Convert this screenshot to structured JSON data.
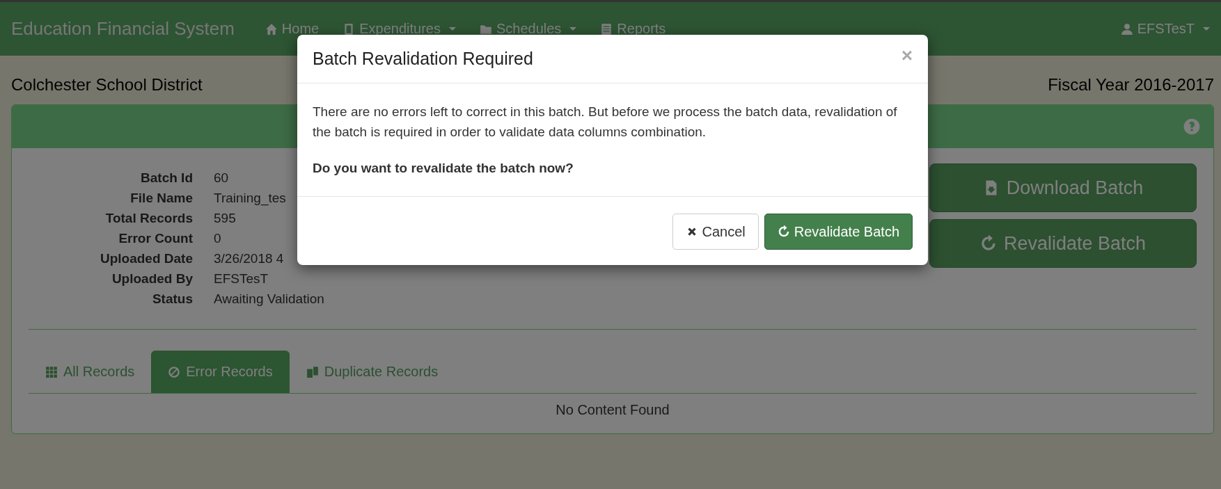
{
  "navbar": {
    "brand": "Education Financial System",
    "items": [
      {
        "label": "Home",
        "dropdown": false
      },
      {
        "label": "Expenditures",
        "dropdown": true
      },
      {
        "label": "Schedules",
        "dropdown": true
      },
      {
        "label": "Reports",
        "dropdown": false
      }
    ],
    "user": {
      "label": "EFSTesT",
      "dropdown": true
    }
  },
  "header": {
    "district": "Colchester School District",
    "fiscal_year": "Fiscal Year 2016-2017"
  },
  "panel": {
    "details": [
      {
        "label": "Batch Id",
        "value": "60"
      },
      {
        "label": "File Name",
        "value": "Training_tes"
      },
      {
        "label": "Total Records",
        "value": "595"
      },
      {
        "label": "Error Count",
        "value": "0"
      },
      {
        "label": "Uploaded Date",
        "value": "3/26/2018 4"
      },
      {
        "label": "Uploaded By",
        "value": "EFSTesT"
      },
      {
        "label": "Status",
        "value": "Awaiting Validation"
      }
    ],
    "actions": [
      {
        "label": "Download Batch"
      },
      {
        "label": "Revalidate Batch"
      }
    ],
    "tabs": [
      {
        "label": "All Records",
        "selected": false
      },
      {
        "label": "Error Records",
        "selected": true
      },
      {
        "label": "Duplicate Records",
        "selected": false
      }
    ],
    "empty_message": "No Content Found"
  },
  "modal": {
    "title": "Batch Revalidation Required",
    "close": "×",
    "message": "There are no errors left to correct in this batch. But before we process the batch data, revalidation of the batch is required in order to validate data columns combination.",
    "question": "Do you want to revalidate the batch now?",
    "buttons": [
      {
        "kind": "default",
        "label": "Cancel"
      },
      {
        "kind": "primary",
        "label": "Revalidate Batch"
      }
    ]
  }
}
